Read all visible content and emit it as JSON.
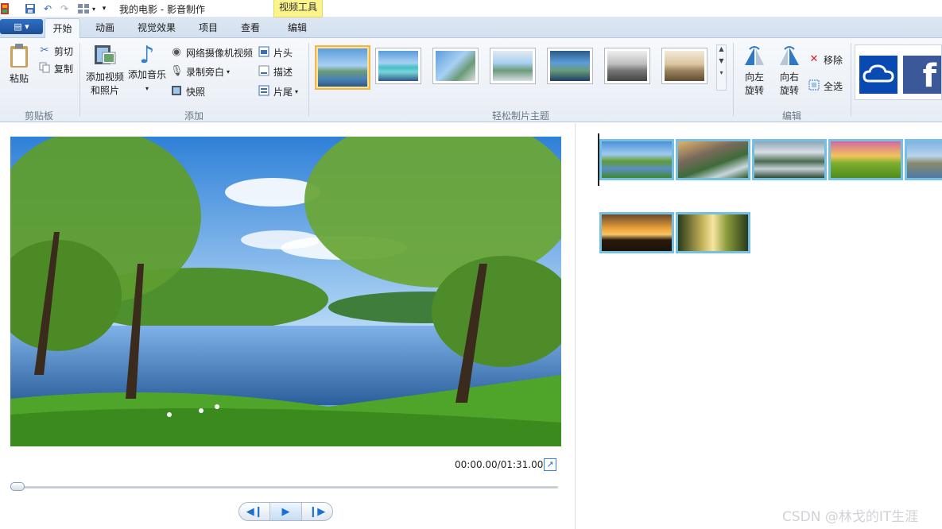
{
  "titlebar": {
    "title": "我的电影 - 影音制作",
    "context_tab": "视频工具"
  },
  "tabs": [
    {
      "label": "开始",
      "active": true
    },
    {
      "label": "动画",
      "active": false
    },
    {
      "label": "视觉效果",
      "active": false
    },
    {
      "label": "项目",
      "active": false
    },
    {
      "label": "查看",
      "active": false
    },
    {
      "label": "编辑",
      "active": false
    }
  ],
  "ribbon": {
    "clipboard": {
      "label": "剪贴板",
      "paste": "粘贴",
      "cut": "剪切",
      "copy": "复制"
    },
    "add": {
      "label": "添加",
      "add_video_line1": "添加视频",
      "add_video_line2": "和照片",
      "add_music": "添加音乐",
      "webcam": "网络摄像机视频",
      "narration": "录制旁白",
      "snapshot": "快照",
      "title": "片头",
      "caption": "描述",
      "credits": "片尾"
    },
    "themes": {
      "label": "轻松制片主题",
      "count": 7,
      "selected": 0
    },
    "editing": {
      "label": "编辑",
      "rotate_left_1": "向左",
      "rotate_left_2": "旋转",
      "rotate_right_1": "向右",
      "rotate_right_2": "旋转",
      "remove": "移除",
      "select_all": "全选"
    }
  },
  "preview": {
    "timecode": "00:00.00/01:31.00",
    "seek_position": 0
  },
  "storyboard": {
    "clips_row1": [
      "lake",
      "waterfall",
      "mist-hills",
      "sunset-field",
      "coast"
    ],
    "clips_row2": [
      "sunset-tree",
      "forest-light"
    ]
  },
  "watermark": "CSDN @林戈的IT生涯",
  "colors": {
    "accent": "#74bfe3",
    "context_tab": "#fbf48c",
    "onedrive": "#094ab2",
    "facebook": "#3b5998"
  }
}
